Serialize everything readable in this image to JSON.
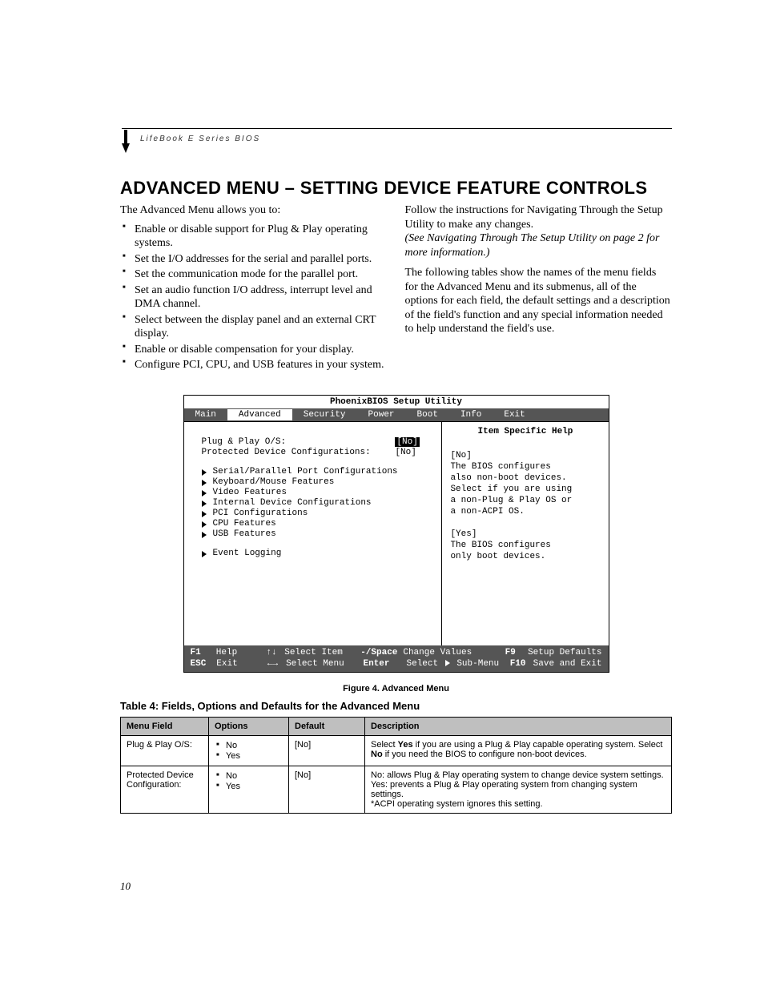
{
  "header": {
    "running": "LifeBook E Series BIOS",
    "title": "ADVANCED MENU – SETTING DEVICE FEATURE CONTROLS"
  },
  "leftCol": {
    "intro": "The Advanced Menu allows you to:",
    "bullets": [
      "Enable or disable support for Plug & Play operating systems.",
      "Set the I/O addresses for the serial and parallel ports.",
      "Set the communication mode for the parallel port.",
      "Set an audio function I/O address, interrupt level and DMA channel.",
      "Select between the display panel and an external CRT display.",
      "Enable or disable compensation for your display.",
      "Configure PCI, CPU, and USB features in your system."
    ]
  },
  "rightCol": {
    "p1": "Follow the instructions for Navigating Through the Setup Utility to make any changes.",
    "p1i": "(See Navigating Through The Setup Utility on page 2 for more information.)",
    "p2": "The following tables show the names of the menu fields for the Advanced Menu and its submenus, all of the options for each field, the default settings and a description of the field's function and any special information needed to help understand the field's use."
  },
  "bios": {
    "title": "PhoenixBIOS Setup Utility",
    "menu": [
      "Main",
      "Advanced",
      "Security",
      "Power",
      "Boot",
      "Info",
      "Exit"
    ],
    "activeMenu": "Advanced",
    "rows": [
      {
        "label": "Plug & Play O/S:",
        "value": "[No]",
        "selected": true
      },
      {
        "label": "Protected Device Configurations:",
        "value": "[No]",
        "selected": false
      }
    ],
    "submenus": [
      "Serial/Parallel Port Configurations",
      "Keyboard/Mouse Features",
      "Video Features",
      "Internal Device Configurations",
      "PCI Configurations",
      "CPU Features",
      "USB Features"
    ],
    "submenus2": [
      "Event Logging"
    ],
    "helpTitle": "Item Specific Help",
    "help": [
      "[No]",
      "The BIOS configures",
      "also non-boot devices.",
      "Select if you are using",
      "a non-Plug & Play OS or",
      "a non-ACPI OS.",
      "",
      "[Yes]",
      "The BIOS configures",
      "only boot devices."
    ],
    "footer": {
      "r1": {
        "k1": "F1",
        "t1": "Help",
        "k2": "↑↓",
        "t2": "Select Item",
        "k3": "-/Space",
        "t3": "Change Values",
        "k4": "F9",
        "t4": "Setup Defaults"
      },
      "r2": {
        "k1": "ESC",
        "t1": "Exit",
        "k2": "←→",
        "t2": "Select Menu",
        "k3": "Enter",
        "t3a": "Select",
        "t3b": "Sub-Menu",
        "k4": "F10",
        "t4": "Save and Exit"
      }
    }
  },
  "figureCaption": "Figure 4.  Advanced Menu",
  "tableCaption": "Table 4: Fields, Options and Defaults for the Advanced Menu",
  "table": {
    "headers": [
      "Menu Field",
      "Options",
      "Default",
      "Description"
    ],
    "rows": [
      {
        "field": "Plug & Play O/S:",
        "options": [
          "No",
          "Yes"
        ],
        "default": "[No]",
        "desc": "Select <b>Yes</b> if you are using a Plug & Play capable operating system. Select <b>No</b> if you need the BIOS to configure non-boot devices."
      },
      {
        "field": "Protected Device Configuration:",
        "options": [
          "No",
          "Yes"
        ],
        "default": "[No]",
        "desc": "No: allows Plug & Play operating system to change device system settings.<br>Yes: prevents a Plug & Play operating system from changing system settings.<br>*ACPI operating system ignores this setting."
      }
    ]
  },
  "pageNumber": "10"
}
